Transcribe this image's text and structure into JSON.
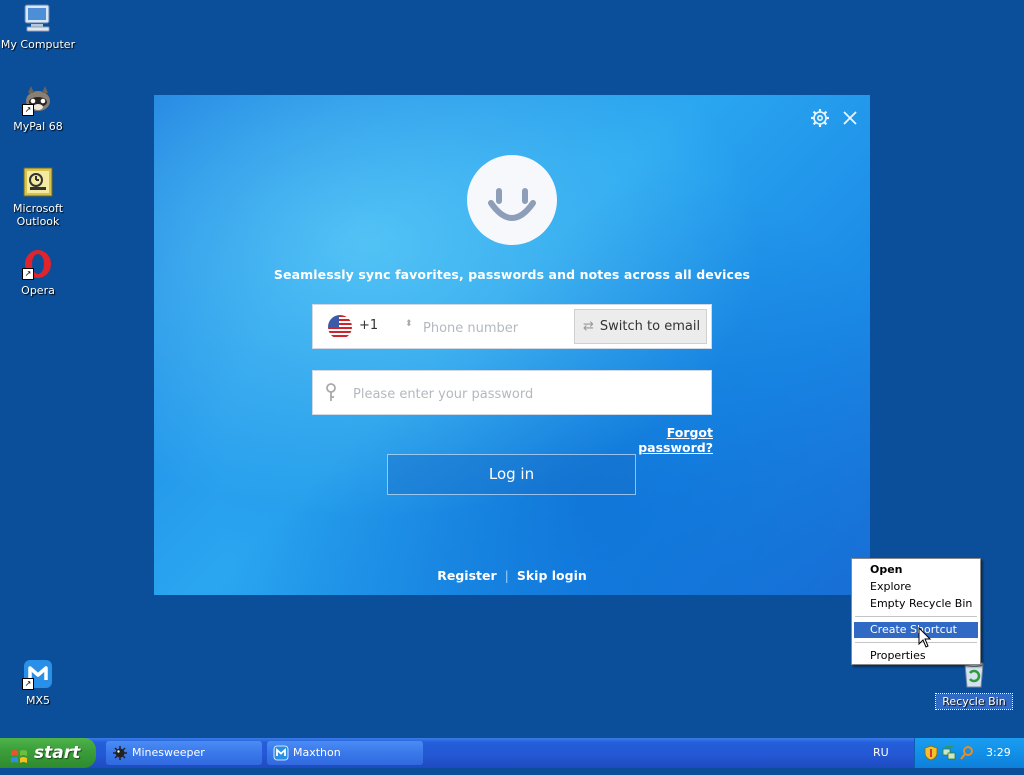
{
  "desktop": {
    "icons": [
      {
        "label": "My Computer"
      },
      {
        "label": "MyPal 68"
      },
      {
        "label": "Microsoft Outlook"
      },
      {
        "label": "Opera"
      },
      {
        "label": "MX5"
      },
      {
        "label": "Recycle Bin"
      }
    ]
  },
  "dialog": {
    "tagline": "Seamlessly sync favorites, passwords and notes across all devices",
    "country_code": "+1",
    "phone_placeholder": "Phone number",
    "switch_label": "Switch to email",
    "password_placeholder": "Please enter your password",
    "forgot_label": "Forgot password?",
    "login_label": "Log in",
    "register_label": "Register",
    "skip_label": "Skip login"
  },
  "context_menu": {
    "items": [
      "Open",
      "Explore",
      "Empty Recycle Bin",
      "Create Shortcut",
      "Properties"
    ],
    "highlighted": "Create Shortcut"
  },
  "taskbar": {
    "start_label": "start",
    "tasks": [
      "Minesweeper",
      "Maxthon"
    ],
    "language": "RU",
    "clock": "3:29"
  },
  "colors": {
    "desktop": "#0b4f9b",
    "menu_highlight": "#316ac5",
    "start_green": "#3c9f3a"
  }
}
